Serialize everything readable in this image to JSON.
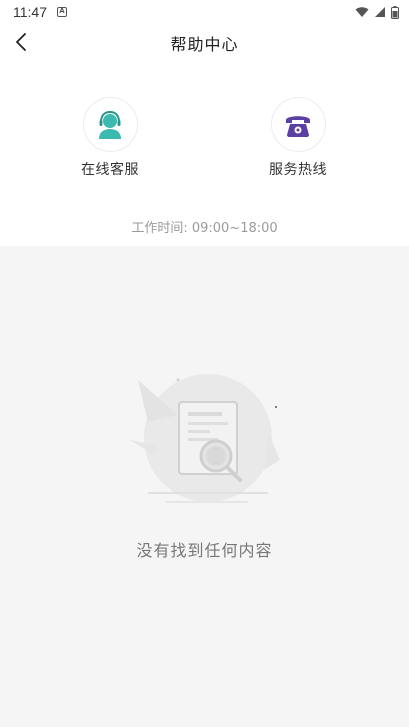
{
  "status_bar": {
    "time": "11:47",
    "notification_icon": "a-notification-icon",
    "wifi_icon": "wifi-icon",
    "signal_icon": "signal-icon",
    "battery_icon": "battery-icon"
  },
  "header": {
    "back_icon": "chevron-left-icon",
    "title": "帮助中心"
  },
  "services": {
    "online": {
      "label": "在线客服",
      "icon": "customer-service-icon",
      "color": "#3dbab0"
    },
    "hotline": {
      "label": "服务热线",
      "icon": "phone-icon",
      "color": "#5b3fa3"
    },
    "work_time": "工作时间: 09:00~18:00"
  },
  "empty_state": {
    "icon": "empty-document-search-icon",
    "text": "没有找到任何内容"
  }
}
